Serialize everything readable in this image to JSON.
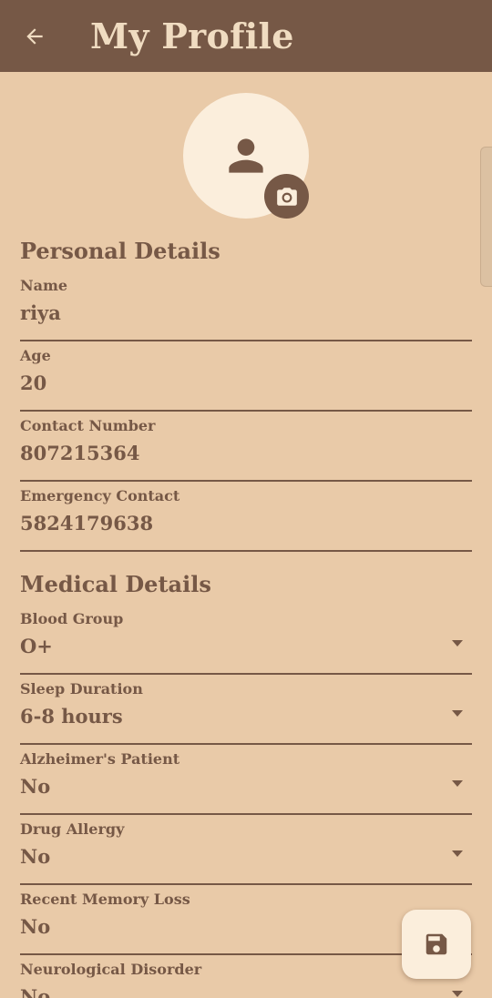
{
  "app_bar": {
    "title": "My Profile",
    "back_icon": "arrow-left-icon"
  },
  "avatar": {
    "icon": "person-icon",
    "camera_icon": "camera-icon"
  },
  "personal": {
    "title": "Personal Details",
    "name": {
      "label": "Name",
      "value": "riya"
    },
    "age": {
      "label": "Age",
      "value": "20"
    },
    "contact": {
      "label": "Contact Number",
      "value": "807215364"
    },
    "emergency": {
      "label": "Emergency Contact",
      "value": "5824179638"
    }
  },
  "medical": {
    "title": "Medical Details",
    "blood_group": {
      "label": "Blood Group",
      "value": "O+"
    },
    "sleep": {
      "label": "Sleep Duration",
      "value": "6-8 hours"
    },
    "alzheimers": {
      "label": "Alzheimer's Patient",
      "value": "No"
    },
    "drug_allergy": {
      "label": "Drug Allergy",
      "value": "No"
    },
    "memory_loss": {
      "label": "Recent Memory Loss",
      "value": "No"
    },
    "neuro": {
      "label": "Neurological Disorder",
      "value": "No"
    }
  },
  "fab": {
    "icon": "save-icon"
  },
  "colors": {
    "primary": "#765846",
    "background": "#e9caa8",
    "surface": "#fbeedc",
    "title_text": "#f0dcc1"
  }
}
